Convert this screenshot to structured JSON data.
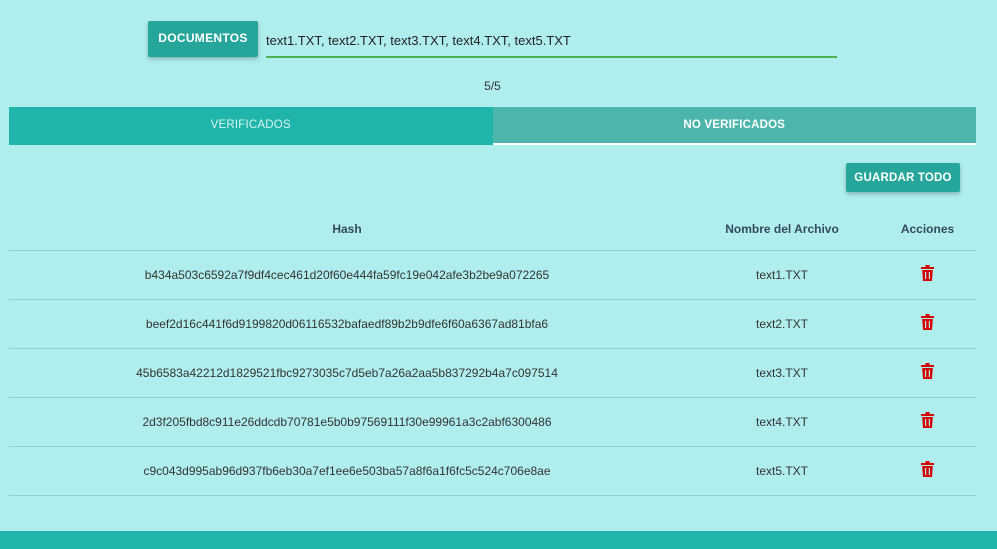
{
  "upload": {
    "button_label": "DOCUMENTOS",
    "selected_files": "text1.TXT, text2.TXT, text3.TXT, text4.TXT, text5.TXT"
  },
  "counter": "5/5",
  "tabs": [
    {
      "label": "VERIFICADOS",
      "active": true
    },
    {
      "label": "NO VERIFICADOS",
      "active": false
    }
  ],
  "save_all_label": "GUARDAR TODO",
  "table": {
    "headers": {
      "hash": "Hash",
      "name": "Nombre del Archivo",
      "actions": "Acciones"
    },
    "rows": [
      {
        "hash": "b434a503c6592a7f9df4cec461d20f60e444fa59fc19e042afe3b2be9a072265",
        "name": "text1.TXT",
        "action_icon": "trash-icon"
      },
      {
        "hash": "beef2d16c441f6d9199820d06116532bafaedf89b2b9dfe6f60a6367ad81bfa6",
        "name": "text2.TXT",
        "action_icon": "trash-icon"
      },
      {
        "hash": "45b6583a42212d1829521fbc9273035c7d5eb7a26a2aa5b837292b4a7c097514",
        "name": "text3.TXT",
        "action_icon": "trash-icon"
      },
      {
        "hash": "2d3f205fbd8c911e26ddcdb70781e5b0b97569111f30e99961a3c2abf6300486",
        "name": "text4.TXT",
        "action_icon": "trash-icon"
      },
      {
        "hash": "c9c043d995ab96d937fb6eb30a7ef1ee6e503ba57a8f6a1f6fc5c524c706e8ae",
        "name": "text5.TXT",
        "action_icon": "trash-icon"
      }
    ]
  },
  "colors": {
    "background": "#b0eeee",
    "primary": "#26a69a",
    "tab_active": "#1fb5ab",
    "tab_inactive": "#4db6ac",
    "input_underline": "#4caf50",
    "delete_icon": "#d50000"
  }
}
